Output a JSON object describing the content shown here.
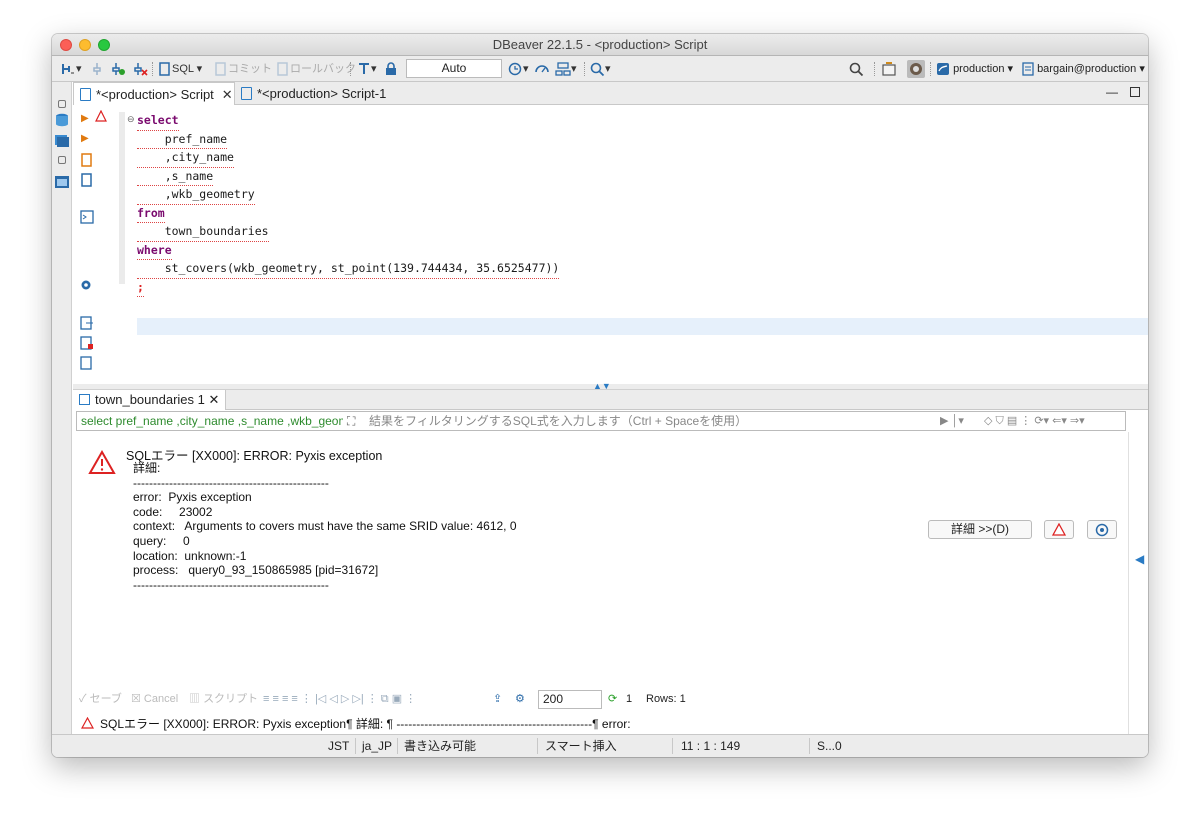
{
  "window": {
    "title": "DBeaver 22.1.5 - <production> Script"
  },
  "toolbar": {
    "sql_label": "SQL",
    "commit_label": "コミット",
    "rollback_label": "ロールバック",
    "auto_mode": "Auto",
    "datasource": "production",
    "schema": "bargain@production"
  },
  "tabs": [
    {
      "label": "*<production> Script",
      "active": true
    },
    {
      "label": "*<production> Script-1",
      "active": false
    }
  ],
  "editor": {
    "lines": [
      {
        "t": "select",
        "kw": true
      },
      {
        "t": "    pref_name"
      },
      {
        "t": "    ,city_name"
      },
      {
        "t": "    ,s_name"
      },
      {
        "t": "    ,wkb_geometry"
      },
      {
        "t": "from",
        "kw": true
      },
      {
        "t": "    town_boundaries"
      },
      {
        "t": "where",
        "kw": true
      },
      {
        "t": "    st_covers(wkb_geometry, st_point(139.744434, 35.6525477))"
      },
      {
        "t": ";"
      }
    ]
  },
  "results": {
    "tab_label": "town_boundaries 1",
    "filter_query": "select pref_name ,city_name ,s_name ,wkb_geometry",
    "filter_placeholder": "結果をフィルタリングするSQL式を入力します（Ctrl + Spaceを使用）",
    "error_title": "SQLエラー [XX000]: ERROR: Pyxis exception",
    "error_body": "詳細: \n-------------------------------------------------\nerror:  Pyxis exception\ncode:     23002\ncontext:   Arguments to covers must have the same SRID value: 4612, 0\nquery:     0\nlocation:  unknown:-1\nprocess:   query0_93_150865985 [pid=31672]\n-------------------------------------------------",
    "details_button": "詳細 >>(D)"
  },
  "bottombar": {
    "save": "セーブ",
    "cancel": "Cancel",
    "script": "スクリプト",
    "fetch_size": "200",
    "refresh_count": "1",
    "rows": "Rows: 1"
  },
  "error_line": "SQLエラー [XX000]: ERROR: Pyxis exception¶  詳細: ¶  -------------------------------------------------¶  error:",
  "statusbar": {
    "tz": "JST",
    "locale": "ja_JP",
    "writable": "書き込み可能",
    "insert_mode": "スマート挿入",
    "position": "11 : 1 : 149",
    "sel": "S...0"
  }
}
